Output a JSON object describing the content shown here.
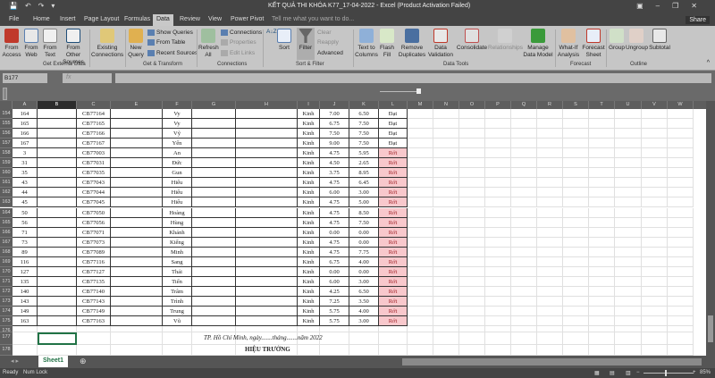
{
  "window": {
    "title": "KẾT QUẢ THI KHÓA K77_17-04-2022 - Excel (Product Activation Failed)",
    "share": "Share"
  },
  "tabs": [
    "File",
    "Home",
    "Insert",
    "Page Layout",
    "Formulas",
    "Data",
    "Review",
    "View",
    "Power Pivot"
  ],
  "active_tab": "Data",
  "tell_me": "Tell me what you want to do...",
  "ribbon": {
    "get_external": {
      "label": "Get External Data",
      "from_access": "From Access",
      "from_web": "From Web",
      "from_text": "From Text",
      "from_other": "From Other Sources",
      "existing": "Existing Connections"
    },
    "transform": {
      "label": "Get & Transform",
      "new_query": "New Query",
      "show_queries": "Show Queries",
      "from_table": "From Table",
      "recent_sources": "Recent Sources"
    },
    "connections": {
      "label": "Connections",
      "refresh": "Refresh All",
      "connections": "Connections",
      "properties": "Properties",
      "edit_links": "Edit Links"
    },
    "sort_filter": {
      "label": "Sort & Filter",
      "sort": "Sort",
      "filter": "Filter",
      "clear": "Clear",
      "reapply": "Reapply",
      "advanced": "Advanced"
    },
    "data_tools": {
      "label": "Data Tools",
      "text_to_columns": "Text to Columns",
      "flash_fill": "Flash Fill",
      "remove_duplicates": "Remove Duplicates",
      "data_validation": "Data Validation",
      "consolidate": "Consolidate",
      "relationships": "Relationships",
      "manage_model": "Manage Data Model"
    },
    "forecast": {
      "label": "Forecast",
      "what_if": "What-If Analysis",
      "forecast_sheet": "Forecast Sheet"
    },
    "outline": {
      "label": "Outline",
      "group": "Group",
      "ungroup": "Ungroup",
      "subtotal": "Subtotal"
    }
  },
  "formula_bar": {
    "name_box": "B177",
    "fx": "fx",
    "value": ""
  },
  "columns": [
    "A",
    "B",
    "C",
    "E",
    "F",
    "G",
    "H",
    "I",
    "J",
    "K",
    "L",
    "M",
    "N",
    "O",
    "P",
    "Q",
    "R",
    "S",
    "T",
    "U",
    "V",
    "W"
  ],
  "selected_column": "B",
  "rows": [
    {
      "n": "154",
      "a": "164",
      "c": "CB77164",
      "f": "Vy",
      "i": "Kinh",
      "j": "7.00",
      "k": "6.50",
      "l": "Đạt"
    },
    {
      "n": "155",
      "a": "165",
      "c": "CB77165",
      "f": "Vy",
      "i": "Kinh",
      "j": "6.75",
      "k": "7.50",
      "l": "Đạt"
    },
    {
      "n": "156",
      "a": "166",
      "c": "CB77166",
      "f": "Vỹ",
      "i": "Kinh",
      "j": "7.50",
      "k": "7.50",
      "l": "Đạt"
    },
    {
      "n": "157",
      "a": "167",
      "c": "CB77167",
      "f": "Yến",
      "i": "Kinh",
      "j": "9.00",
      "k": "7.50",
      "l": "Đạt"
    },
    {
      "n": "158",
      "a": "3",
      "c": "CB77003",
      "f": "An",
      "i": "Kinh",
      "j": "4.75",
      "k": "5.95",
      "l": "Rớt"
    },
    {
      "n": "159",
      "a": "31",
      "c": "CB77031",
      "f": "Đức",
      "i": "Kinh",
      "j": "4.50",
      "k": "2.65",
      "l": "Rớt"
    },
    {
      "n": "160",
      "a": "35",
      "c": "CB77035",
      "f": "Gun",
      "i": "Kinh",
      "j": "3.75",
      "k": "8.95",
      "l": "Rớt"
    },
    {
      "n": "161",
      "a": "43",
      "c": "CB77043",
      "f": "Hiếu",
      "i": "Kinh",
      "j": "4.75",
      "k": "6.45",
      "l": "Rớt"
    },
    {
      "n": "162",
      "a": "44",
      "c": "CB77044",
      "f": "Hiếu",
      "i": "Kinh",
      "j": "6.00",
      "k": "3.00",
      "l": "Rớt"
    },
    {
      "n": "163",
      "a": "45",
      "c": "CB77045",
      "f": "Hiếu",
      "i": "Kinh",
      "j": "4.75",
      "k": "5.00",
      "l": "Rớt"
    },
    {
      "n": "164",
      "a": "50",
      "c": "CB77050",
      "f": "Hoàng",
      "i": "Kinh",
      "j": "4.75",
      "k": "8.50",
      "l": "Rớt"
    },
    {
      "n": "165",
      "a": "56",
      "c": "CB77056",
      "f": "Hùng",
      "i": "Kinh",
      "j": "4.75",
      "k": "7.50",
      "l": "Rớt"
    },
    {
      "n": "166",
      "a": "71",
      "c": "CB77071",
      "f": "Khánh",
      "i": "Kinh",
      "j": "0.00",
      "k": "0.00",
      "l": "Rớt"
    },
    {
      "n": "167",
      "a": "73",
      "c": "CB77073",
      "f": "Kiếng",
      "i": "Kinh",
      "j": "4.75",
      "k": "0.00",
      "l": "Rớt"
    },
    {
      "n": "168",
      "a": "89",
      "c": "CB77089",
      "f": "Minh",
      "i": "Kinh",
      "j": "4.75",
      "k": "7.75",
      "l": "Rớt"
    },
    {
      "n": "169",
      "a": "116",
      "c": "CB77116",
      "f": "Sang",
      "i": "Kinh",
      "j": "6.75",
      "k": "4.00",
      "l": "Rớt"
    },
    {
      "n": "170",
      "a": "127",
      "c": "CB77127",
      "f": "Thái",
      "i": "Kinh",
      "j": "0.00",
      "k": "0.00",
      "l": "Rớt"
    },
    {
      "n": "171",
      "a": "135",
      "c": "CB77135",
      "f": "Tiến",
      "i": "Kinh",
      "j": "6.00",
      "k": "3.00",
      "l": "Rớt"
    },
    {
      "n": "172",
      "a": "140",
      "c": "CB77140",
      "f": "Trâm",
      "i": "Kinh",
      "j": "4.25",
      "k": "6.50",
      "l": "Rớt"
    },
    {
      "n": "173",
      "a": "143",
      "c": "CB77143",
      "f": "Trình",
      "i": "Kinh",
      "j": "7.25",
      "k": "3.50",
      "l": "Rớt"
    },
    {
      "n": "174",
      "a": "149",
      "c": "CB77149",
      "f": "Trung",
      "i": "Kinh",
      "j": "5.75",
      "k": "4.00",
      "l": "Rớt"
    },
    {
      "n": "175",
      "a": "163",
      "c": "CB77163",
      "f": "Vũ",
      "i": "Kinh",
      "j": "5.75",
      "k": "3.00",
      "l": "Rớt"
    }
  ],
  "extra_rows": [
    "176",
    "177",
    "178",
    "179"
  ],
  "footer_note": "TP. Hồ Chí Minh, ngày.......tháng.......năm 2022",
  "signature_title": "HIỆU TRƯỞNG",
  "sheets": [
    "Sheet1"
  ],
  "status": {
    "ready": "Ready",
    "num_lock": "Num Lock",
    "zoom": "85%",
    "zoom_level": 0.85
  },
  "colors": {
    "fail_fill": "#f8c8cc",
    "fail_text": "#a2252b",
    "accent": "#217346"
  }
}
